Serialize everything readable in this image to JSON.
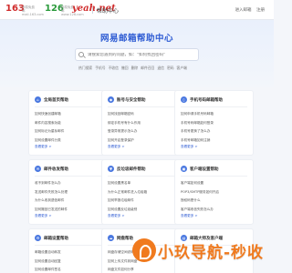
{
  "header": {
    "brand_163": "163",
    "brand_163_sub": "网易免费邮 mail.163.com",
    "brand_126": "126",
    "brand_126_sub": "网易免费邮 www.126.com",
    "brand_yeah": "yeah.net",
    "help_center": "帮助中心",
    "login": "进入邮箱",
    "register": "注册"
  },
  "hero": {
    "title": "网易邮箱帮助中心",
    "search_placeholder": "请搜索您遇到的问题，如：\"如何找回密码\"",
    "hot_tags": [
      "热门搜索",
      "手机号",
      "不收信",
      "撤回",
      "删除",
      "邮件召回",
      "退信",
      "密码",
      "客户端"
    ]
  },
  "cards": [
    {
      "title": "全局首页帮助",
      "icon": "home-icon",
      "items": [
        "如何快速创建邮箱",
        "邮件内容搜索功能",
        "如何标记为星标邮件",
        "如何设置邮件分类"
      ],
      "more": "查看更多 >"
    },
    {
      "title": "账号与安全帮助",
      "icon": "shield-icon",
      "items": [
        "如何找回邮箱密码",
        "绑定手机号有什么作用",
        "登录异常提示怎么办",
        "如何开启登录保护"
      ],
      "more": "查看更多 >"
    },
    {
      "title": "手机号码邮箱帮助",
      "icon": "phone-icon",
      "items": [
        "如何申请手机号码邮箱",
        "手机号码邮箱如何登录",
        "手机号更换了怎么办",
        "手机号邮箱如何注销"
      ],
      "more": "查看更多 >"
    },
    {
      "title": "邮件收发帮助",
      "icon": "mail-icon",
      "items": [
        "收不到邮件怎么办",
        "发送邮件失败怎么处理",
        "为什么收到退信邮件",
        "如何撤回已发送的邮件"
      ],
      "more": "查看更多 >"
    },
    {
      "title": "反垃圾邮件帮助",
      "icon": "filter-icon",
      "items": [
        "如何设置黑名单",
        "为什么正常邮件进入垃圾箱",
        "如何举报垃圾邮件",
        "如何设置反垃圾级别"
      ],
      "more": "查看更多 >"
    },
    {
      "title": "客户端设置帮助",
      "icon": "client-icon",
      "items": [
        "客户端如何设置",
        "POP3/SMTP服务如何开启",
        "授权码是什么",
        "客户端收信失败怎么办"
      ],
      "more": "查看更多 >"
    },
    {
      "title": "邮箱设置帮助",
      "icon": "gear-icon",
      "items": [
        "邮箱设置自动转发",
        "如何设置自动回复",
        "如何设置邮件签名"
      ],
      "more": "查看更多 >"
    },
    {
      "title": "网盘帮助",
      "icon": "cloud-icon",
      "items": [
        "网盘存储空间说明",
        "如何上传文件到网盘",
        "网盘文件如何分享"
      ],
      "more": "查看更多 >"
    },
    {
      "title": "邮箱大师及客户端",
      "icon": "app-icon",
      "items": [
        "邮箱大师如何下载",
        "如何添加多个邮箱",
        "邮箱大师推送设置"
      ],
      "more": "查看更多 >"
    }
  ],
  "overlay": {
    "banner_text": "小玖导航-秒收"
  }
}
